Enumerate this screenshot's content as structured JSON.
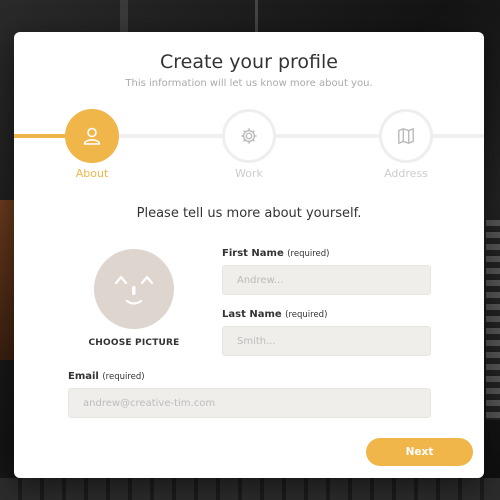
{
  "header": {
    "title": "Create your profile",
    "subtitle": "This information will let us know more about you."
  },
  "wizard": {
    "steps": [
      {
        "label": "About",
        "icon": "user-icon",
        "active": true
      },
      {
        "label": "Work",
        "icon": "gear-icon",
        "active": false
      },
      {
        "label": "Address",
        "icon": "map-icon",
        "active": false
      }
    ],
    "progress": 0.2,
    "accent_color": "#f0b64a"
  },
  "form": {
    "prompt": "Please tell us more about yourself.",
    "choose_picture": "CHOOSE PICTURE",
    "first_name": {
      "label": "First Name",
      "required": "(required)",
      "placeholder": "Andrew..."
    },
    "last_name": {
      "label": "Last Name",
      "required": "(required)",
      "placeholder": "Smith..."
    },
    "email": {
      "label": "Email",
      "required": "(required)",
      "placeholder": "andrew@creative-tim.com"
    },
    "next_label": "Next"
  }
}
